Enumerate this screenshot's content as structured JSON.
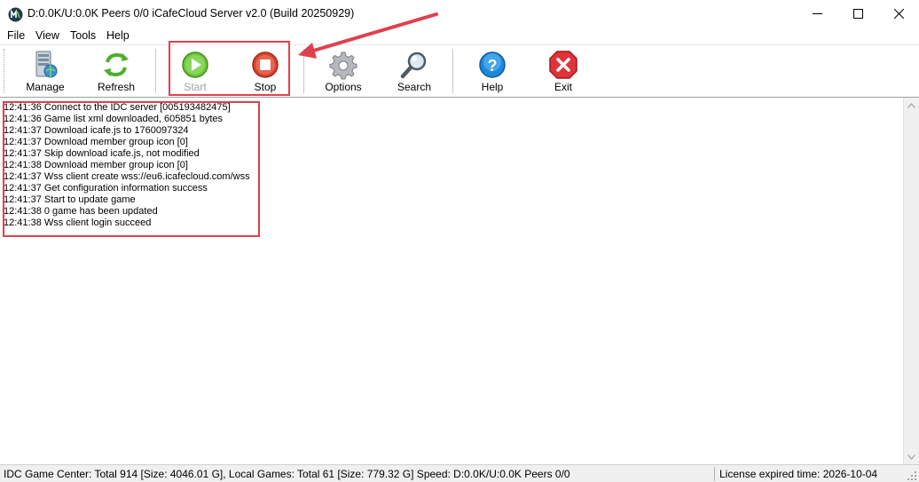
{
  "window": {
    "title": "D:0.0K/U:0.0K Peers 0/0 iCafeCloud Server v2.0 (Build 20250929)",
    "app_icon": "iCafeCloud-logo",
    "controls": [
      "minimize-icon",
      "maximize-icon",
      "close-icon"
    ]
  },
  "menu": {
    "items": [
      {
        "label": "File"
      },
      {
        "label": "View"
      },
      {
        "label": "Tools"
      },
      {
        "label": "Help"
      }
    ]
  },
  "toolbar": {
    "buttons": [
      {
        "label": "Manage",
        "icon": "manage-server-icon",
        "enabled": true
      },
      {
        "label": "Refresh",
        "icon": "refresh-icon",
        "enabled": true
      },
      {
        "label": "Start",
        "icon": "play-icon",
        "enabled": false
      },
      {
        "label": "Stop",
        "icon": "stop-icon",
        "enabled": true
      },
      {
        "label": "Options",
        "icon": "gear-icon",
        "enabled": true
      },
      {
        "label": "Search",
        "icon": "search-icon",
        "enabled": true
      },
      {
        "label": "Help",
        "icon": "help-icon",
        "enabled": true
      },
      {
        "label": "Exit",
        "icon": "exit-icon",
        "enabled": true
      }
    ]
  },
  "log": {
    "lines": [
      "12:41:36 Connect to the IDC server [005193482475]",
      "12:41:36 Game list xml downloaded, 605851 bytes",
      "12:41:37 Download icafe.js to 1760097324",
      "12:41:37 Download member group icon [0]",
      "12:41:37 Skip download icafe.js, not modified",
      "12:41:38 Download member group icon [0]",
      "12:41:37 Wss client create wss://eu6.icafecloud.com/wss",
      "12:41:37 Get configuration information success",
      "12:41:37 Start to update game",
      "12:41:38 0 game has been updated",
      "12:41:38 Wss client login succeed"
    ]
  },
  "status": {
    "main": "IDC Game Center: Total 914 [Size: 4046.01 G], Local Games: Total 61 [Size: 779.32 G] Speed: D:0.0K/U:0.0K Peers 0/0",
    "license": "License expired time: 2026-10-04"
  },
  "colors": {
    "annotation": "#e0404e",
    "start_green": "#5cb82c",
    "stop_red": "#d9432f",
    "help_blue": "#1e88d8",
    "exit_red": "#e0333a"
  }
}
